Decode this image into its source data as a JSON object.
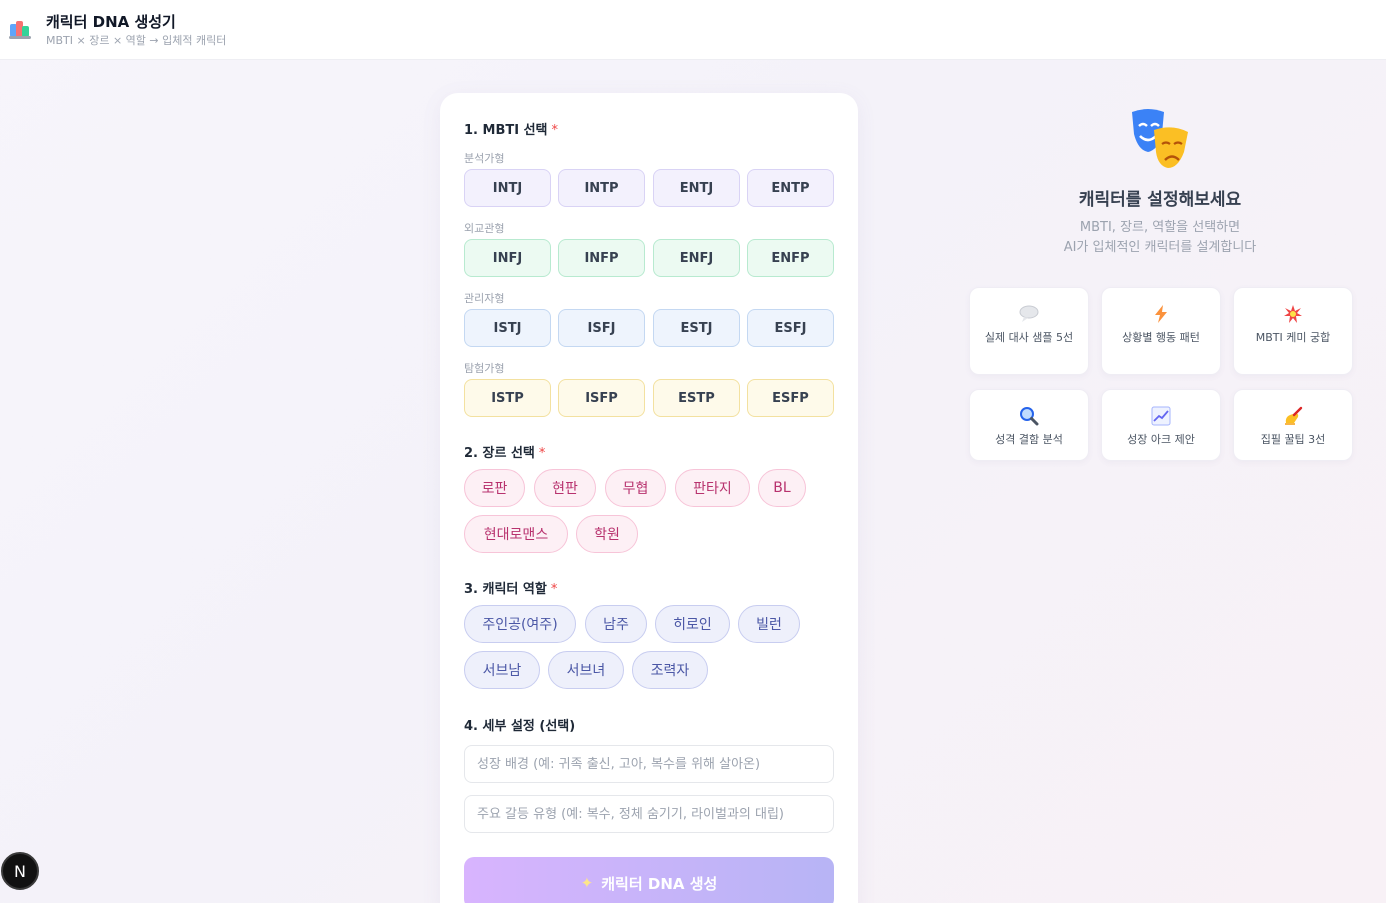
{
  "header": {
    "title": "캐릭터 DNA 생성기",
    "subtitle": "MBTI × 장르 × 역할 → 입체적 캐릭터"
  },
  "mbti": {
    "title": "1. MBTI 선택",
    "required_mark": "*",
    "groups": [
      {
        "label": "분석가형",
        "types": [
          "INTJ",
          "INTP",
          "ENTJ",
          "ENTP"
        ]
      },
      {
        "label": "외교관형",
        "types": [
          "INFJ",
          "INFP",
          "ENFJ",
          "ENFP"
        ]
      },
      {
        "label": "관리자형",
        "types": [
          "ISTJ",
          "ISFJ",
          "ESTJ",
          "ESFJ"
        ]
      },
      {
        "label": "탐험가형",
        "types": [
          "ISTP",
          "ISFP",
          "ESTP",
          "ESFP"
        ]
      }
    ],
    "group_colors": [
      {
        "bg": "#f3f1fd",
        "border": "#d9d3f5"
      },
      {
        "bg": "#ecfaf2",
        "border": "#b8ead0"
      },
      {
        "bg": "#eef4fd",
        "border": "#c4d8f2"
      },
      {
        "bg": "#fefaea",
        "border": "#f3e1a0"
      }
    ]
  },
  "genre": {
    "title": "2. 장르 선택",
    "required_mark": "*",
    "options": [
      "로판",
      "현판",
      "무협",
      "판타지",
      "BL",
      "현대로맨스",
      "학원"
    ]
  },
  "role": {
    "title": "3. 캐릭터 역할",
    "required_mark": "*",
    "options": [
      "주인공(여주)",
      "남주",
      "히로인",
      "빌런",
      "서브남",
      "서브녀",
      "조력자"
    ]
  },
  "details": {
    "title": "4. 세부 설정 (선택)",
    "background_placeholder": "성장 배경 (예: 귀족 출신, 고아, 복수를 위해 살아온)",
    "conflict_placeholder": "주요 갈등 유형 (예: 복수, 정체 숨기기, 라이벌과의 대립)"
  },
  "generate": {
    "icon": "sparkles-icon",
    "label": "캐릭터 DNA 생성"
  },
  "right": {
    "icon": "theater-masks-icon",
    "title": "캐릭터를 설정해보세요",
    "desc_line1": "MBTI, 장르, 역할을 선택하면",
    "desc_line2": "AI가 입체적인 캐릭터를 설계합니다",
    "features": [
      {
        "icon": "speech-bubble-icon",
        "label": "실제 대사 샘플 5선"
      },
      {
        "icon": "lightning-icon",
        "label": "상황별 행동 패턴"
      },
      {
        "icon": "collision-icon",
        "label": "MBTI 케미 궁합"
      },
      {
        "icon": "magnifier-icon",
        "label": "성격 결함 분석"
      },
      {
        "icon": "trend-chart-icon",
        "label": "성장 아크 제안"
      },
      {
        "icon": "writing-hand-icon",
        "label": "집필 꿀팁 3선"
      }
    ]
  },
  "badge": {
    "label": "N"
  }
}
